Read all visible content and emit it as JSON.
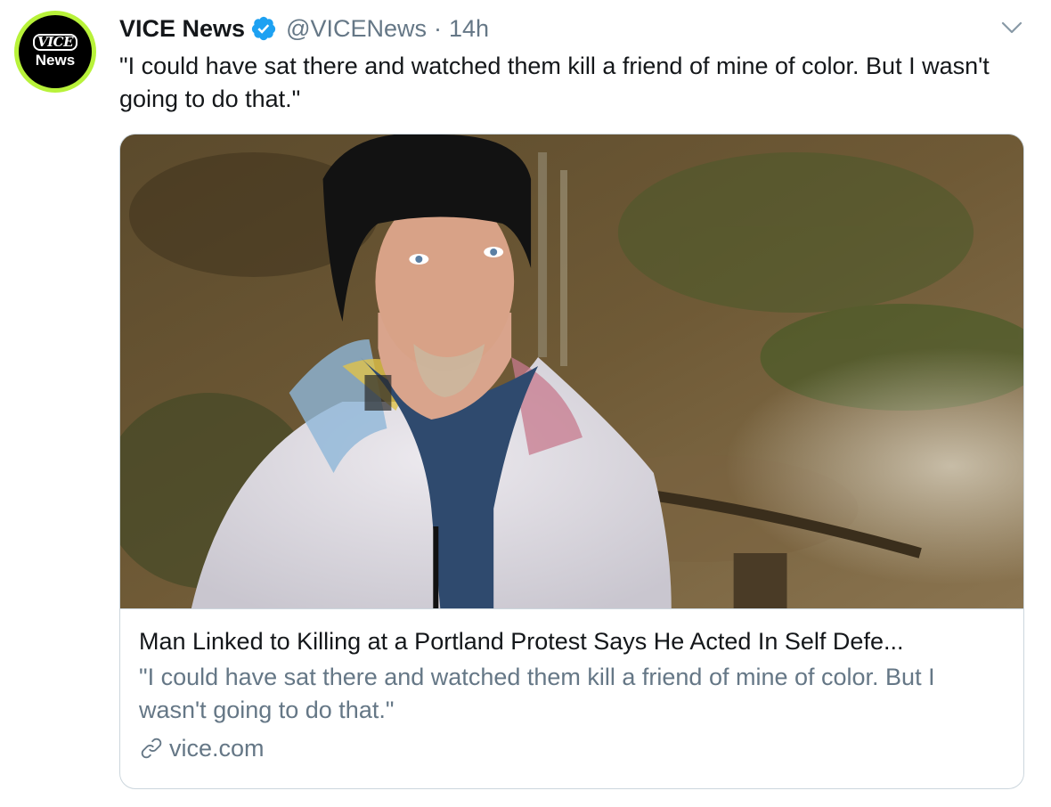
{
  "tweet": {
    "avatar": {
      "brand_text": "VICE",
      "sub_text": "News",
      "ring_color": "#b8f23a"
    },
    "author_name": "VICE News",
    "verified_icon": "verified-badge-icon",
    "handle": "@VICENews",
    "separator": "·",
    "timestamp": "14h",
    "menu_icon": "chevron-down-icon",
    "text": "\"I could have sat there and watched them kill a friend of mine of color. But I wasn't going to do that.\""
  },
  "card": {
    "title": "Man Linked to Killing at a Portland Protest Says He Acted In Self Defe...",
    "description": "\"I could have sat there and watched them kill a friend of mine of color. But I wasn't going to do that.\"",
    "domain": "vice.com",
    "link_icon": "link-icon"
  },
  "colors": {
    "primary_text": "#14171a",
    "secondary_text": "#657786",
    "verified_blue": "#1da1f2",
    "border": "#ccd6dd"
  }
}
